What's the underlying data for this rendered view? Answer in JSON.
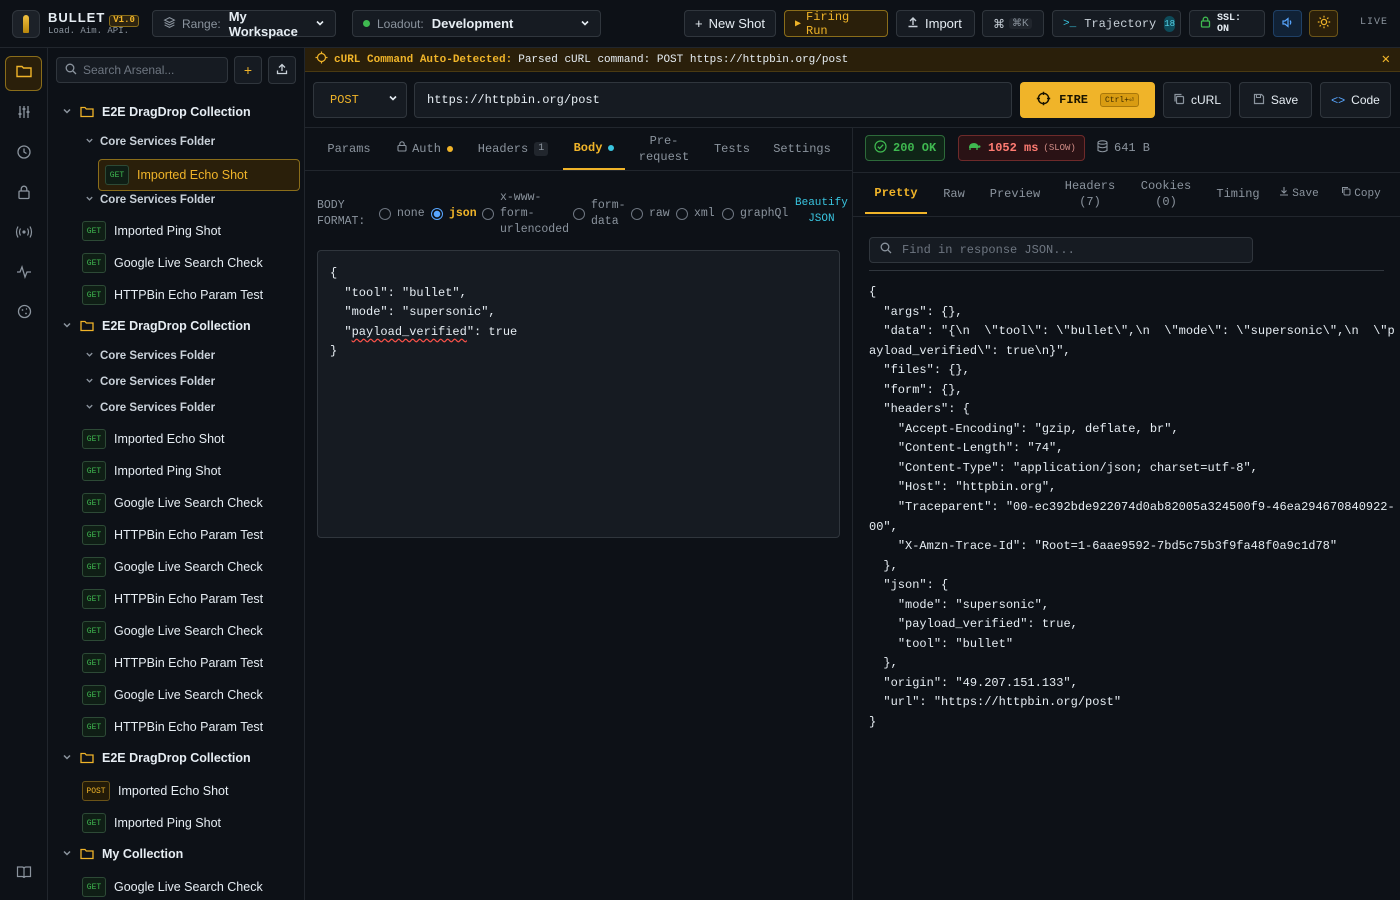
{
  "brand": {
    "name": "BULLET",
    "version": "V1.0",
    "tagline": "Load. Aim. API."
  },
  "header": {
    "range_label": "Range:",
    "range_value": "My Workspace",
    "loadout_label": "Loadout:",
    "loadout_value": "Development",
    "new_shot": "New Shot",
    "firing_run": "Firing Run",
    "import": "Import",
    "shortcut": "⌘K",
    "trajectory": "Trajectory",
    "trajectory_count": "18",
    "ssl": "SSL: ON",
    "live": "LIVE"
  },
  "sidebar": {
    "search_placeholder": "Search Arsenal...",
    "tree": [
      {
        "kind": "collection",
        "label": "E2E DragDrop Collection"
      },
      {
        "kind": "folder",
        "label": "Core Services Folder"
      },
      {
        "kind": "request",
        "method": "GET",
        "label": "Imported Echo Shot",
        "active": true
      },
      {
        "kind": "folder",
        "label": "Core Services Folder"
      },
      {
        "kind": "request",
        "method": "GET",
        "label": "Imported Ping Shot"
      },
      {
        "kind": "request",
        "method": "GET",
        "label": "Google Live Search Check"
      },
      {
        "kind": "request",
        "method": "GET",
        "label": "HTTPBin Echo Param Test"
      },
      {
        "kind": "collection",
        "label": "E2E DragDrop Collection"
      },
      {
        "kind": "folder",
        "label": "Core Services Folder"
      },
      {
        "kind": "folder",
        "label": "Core Services Folder"
      },
      {
        "kind": "folder",
        "label": "Core Services Folder"
      },
      {
        "kind": "request",
        "method": "GET",
        "label": "Imported Echo Shot"
      },
      {
        "kind": "request",
        "method": "GET",
        "label": "Imported Ping Shot"
      },
      {
        "kind": "request",
        "method": "GET",
        "label": "Google Live Search Check"
      },
      {
        "kind": "request",
        "method": "GET",
        "label": "HTTPBin Echo Param Test"
      },
      {
        "kind": "request",
        "method": "GET",
        "label": "Google Live Search Check"
      },
      {
        "kind": "request",
        "method": "GET",
        "label": "HTTPBin Echo Param Test"
      },
      {
        "kind": "request",
        "method": "GET",
        "label": "Google Live Search Check"
      },
      {
        "kind": "request",
        "method": "GET",
        "label": "HTTPBin Echo Param Test"
      },
      {
        "kind": "request",
        "method": "GET",
        "label": "Google Live Search Check"
      },
      {
        "kind": "request",
        "method": "GET",
        "label": "HTTPBin Echo Param Test"
      },
      {
        "kind": "collection",
        "label": "E2E DragDrop Collection"
      },
      {
        "kind": "request",
        "method": "POST",
        "label": "Imported Echo Shot"
      },
      {
        "kind": "request",
        "method": "GET",
        "label": "Imported Ping Shot"
      },
      {
        "kind": "collection",
        "label": "My Collection"
      },
      {
        "kind": "request",
        "method": "GET",
        "label": "Google Live Search Check"
      }
    ]
  },
  "curl_banner": {
    "title": "cURL Command Auto-Detected:",
    "message": "Parsed cURL command: POST https://httpbin.org/post"
  },
  "request": {
    "method": "POST",
    "url": "https://httpbin.org/post",
    "fire_label": "FIRE",
    "fire_shortcut": "Ctrl+⏎",
    "curl_btn": "cURL",
    "save_btn": "Save",
    "code_btn": "Code",
    "tabs": {
      "params": "Params",
      "auth": "Auth",
      "headers": "Headers",
      "headers_count": "1",
      "body": "Body",
      "prereq_1": "Pre-",
      "prereq_2": "request",
      "tests": "Tests",
      "settings": "Settings"
    },
    "body_format_1": "BODY",
    "body_format_2": "FORMAT:",
    "formats": {
      "none": "none",
      "json": "json",
      "urlenc_1": "x-www-",
      "urlenc_2": "form-",
      "urlenc_3": "urlencoded",
      "formdata_1": "form-",
      "formdata_2": "data",
      "raw": "raw",
      "xml": "xml",
      "graphql": "graphQl"
    },
    "beautify_1": "Beautify",
    "beautify_2": "JSON",
    "body_lines": {
      "l1": "{",
      "l2a": "  \"tool\": \"bullet\",",
      "l3a": "  \"mode\": \"supersonic\",",
      "l4a": "  \"",
      "l4b": "payload_verified",
      "l4c": "\": true",
      "l5": "}"
    }
  },
  "response": {
    "status": "200 OK",
    "time": "1052 ms",
    "time_tag": "(SLOW)",
    "size": "641 B",
    "tabs": {
      "pretty": "Pretty",
      "raw": "Raw",
      "preview": "Preview",
      "headers_1": "Headers",
      "headers_2": "(7)",
      "cookies_1": "Cookies",
      "cookies_2": "(0)",
      "timing": "Timing",
      "save": "Save",
      "copy": "Copy"
    },
    "find_placeholder": "Find in response JSON...",
    "body": "{\n  \"args\": {},\n  \"data\": \"{\\n  \\\"tool\\\": \\\"bullet\\\",\\n  \\\"mode\\\": \\\"supersonic\\\",\\n  \\\"payload_verified\\\": true\\n}\",\n  \"files\": {},\n  \"form\": {},\n  \"headers\": {\n    \"Accept-Encoding\": \"gzip, deflate, br\",\n    \"Content-Length\": \"74\",\n    \"Content-Type\": \"application/json; charset=utf-8\",\n    \"Host\": \"httpbin.org\",\n    \"Traceparent\": \"00-ec392bde922074d0ab82005a324500f9-46ea294670840922-00\",\n    \"X-Amzn-Trace-Id\": \"Root=1-6aae9592-7bd5c75b3f9fa48f0a9c1d78\"\n  },\n  \"json\": {\n    \"mode\": \"supersonic\",\n    \"payload_verified\": true,\n    \"tool\": \"bullet\"\n  },\n  \"origin\": \"49.207.151.133\",\n  \"url\": \"https://httpbin.org/post\"\n}"
  },
  "colors": {
    "accent": "#f0b429",
    "success": "#3fb950",
    "danger": "#ff7b72",
    "info": "#39c5e0",
    "background": "#0d1117"
  },
  "icons": [
    "bullet-logo-icon",
    "layers-icon",
    "chevron-down-icon",
    "plus-icon",
    "play-icon",
    "upload-icon",
    "command-icon",
    "terminal-icon",
    "lock-icon",
    "speaker-icon",
    "sun-icon",
    "folder-icon",
    "sliders-icon",
    "clock-icon",
    "broadcast-icon",
    "pulse-icon",
    "cookie-icon",
    "book-icon",
    "search-icon",
    "crosshair-icon",
    "copy-icon",
    "save-icon",
    "code-icon",
    "check-circle-icon",
    "turtle-icon",
    "database-icon",
    "close-icon"
  ]
}
